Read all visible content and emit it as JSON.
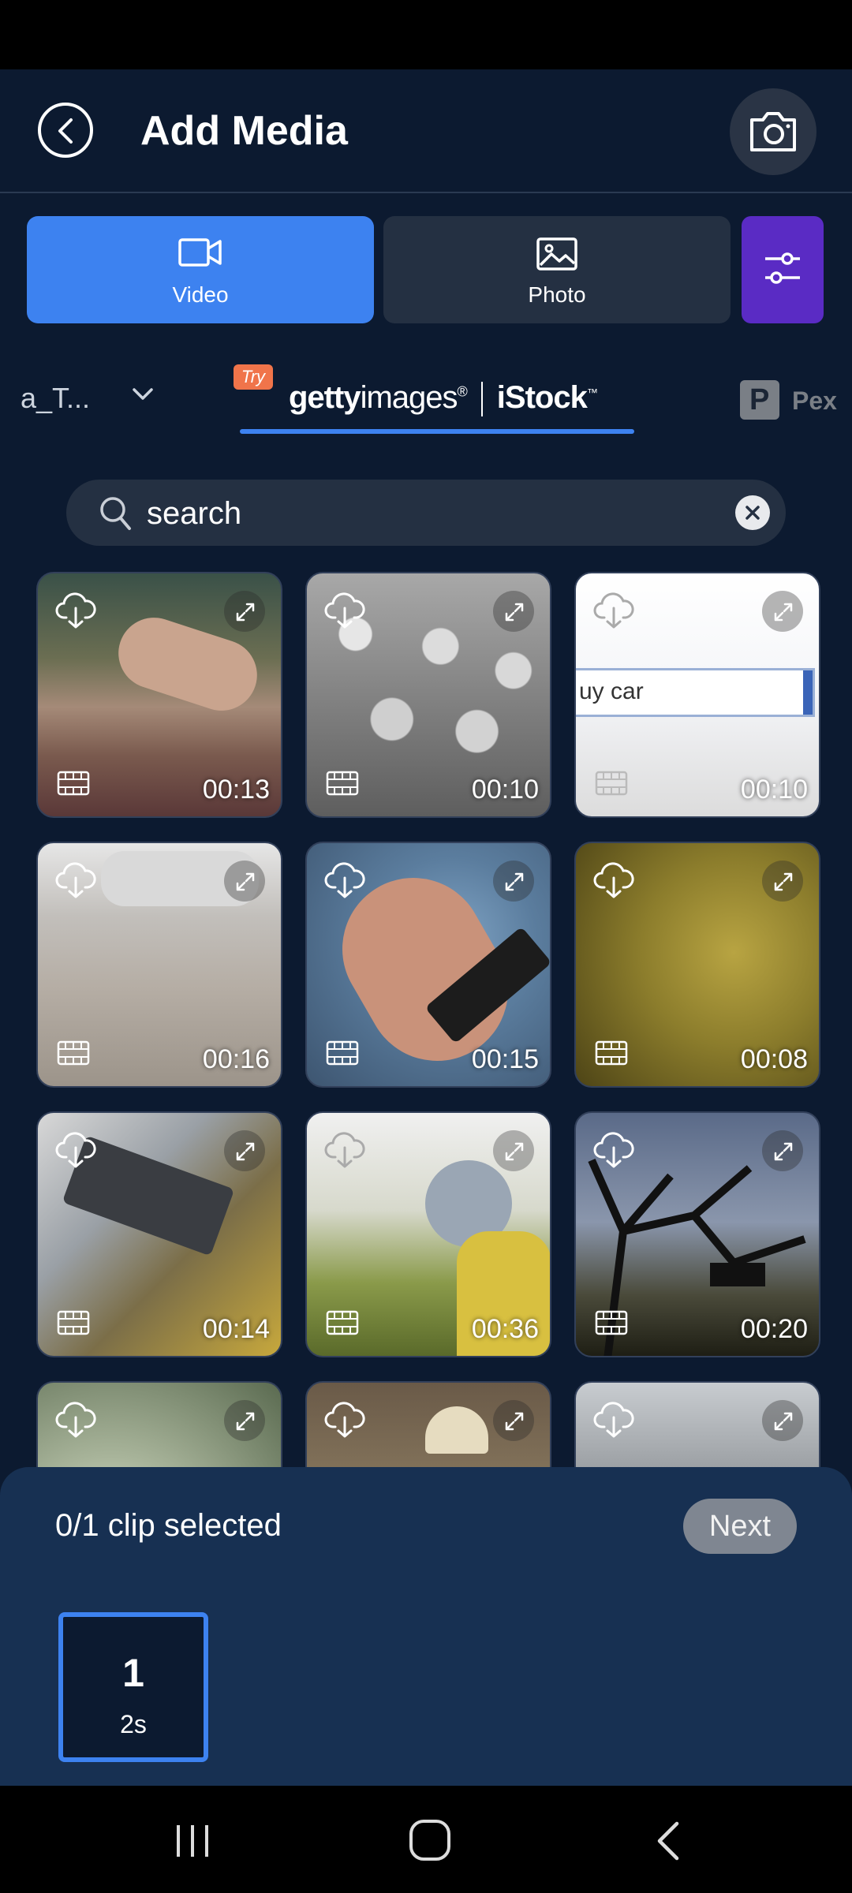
{
  "header": {
    "title": "Add Media"
  },
  "media_types": [
    {
      "label": "Video",
      "icon": "video-camera-icon",
      "selected": true
    },
    {
      "label": "Photo",
      "icon": "image-icon",
      "selected": false
    }
  ],
  "sources": {
    "left_label": "a_T...",
    "try_badge": "Try",
    "getty_a": "getty",
    "getty_b": "images",
    "getty_reg": "®",
    "istock": "iStock",
    "istock_tm": "™",
    "pexels_label": "Pex"
  },
  "search": {
    "value": "search",
    "placeholder": "search"
  },
  "thumbnails": [
    {
      "duration": "00:13"
    },
    {
      "duration": "00:10"
    },
    {
      "duration": "00:10",
      "caption": "uy car"
    },
    {
      "duration": "00:16"
    },
    {
      "duration": "00:15"
    },
    {
      "duration": "00:08"
    },
    {
      "duration": "00:14"
    },
    {
      "duration": "00:36"
    },
    {
      "duration": "00:20"
    }
  ],
  "selection": {
    "status": "0/1 clip selected",
    "next_label": "Next",
    "slot_number": "1",
    "slot_duration": "2s"
  },
  "colors": {
    "accent": "#3d82f0",
    "filter_button": "#5a2bc4",
    "background": "#0c1a30",
    "sheet": "#173052"
  }
}
